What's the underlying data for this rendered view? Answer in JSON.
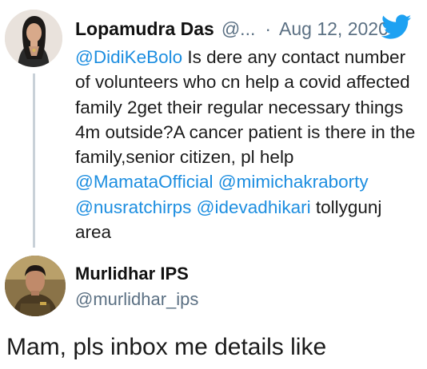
{
  "parent_tweet": {
    "author_name": "Lopamudra Das",
    "author_handle_truncated": "@...",
    "separator": "·",
    "date": "Aug 12, 2020",
    "icon": "twitter-bird-icon",
    "body": {
      "mention_1": "@DidiKeBolo",
      "text_1": " Is dere any contact number of volunteers who cn help a covid affected family 2get their regular necessary things 4m outside?A cancer patient is there in the family,senior citizen, pl help ",
      "mention_2": "@MamataOfficial",
      "mention_3": "@mimichakraborty",
      "mention_4": "@nusratchirps",
      "mention_5": "@idevadhikari",
      "text_2": " tollygunj area"
    }
  },
  "reply_tweet": {
    "author_name": "Murlidhar IPS",
    "author_handle": "@murlidhar_ips",
    "body": "Mam, pls inbox me details like"
  },
  "colors": {
    "mention": "#1d8ee0",
    "twitter_blue": "#1da1f2",
    "muted": "#5b7083",
    "thread_line": "#c9d1d8"
  }
}
